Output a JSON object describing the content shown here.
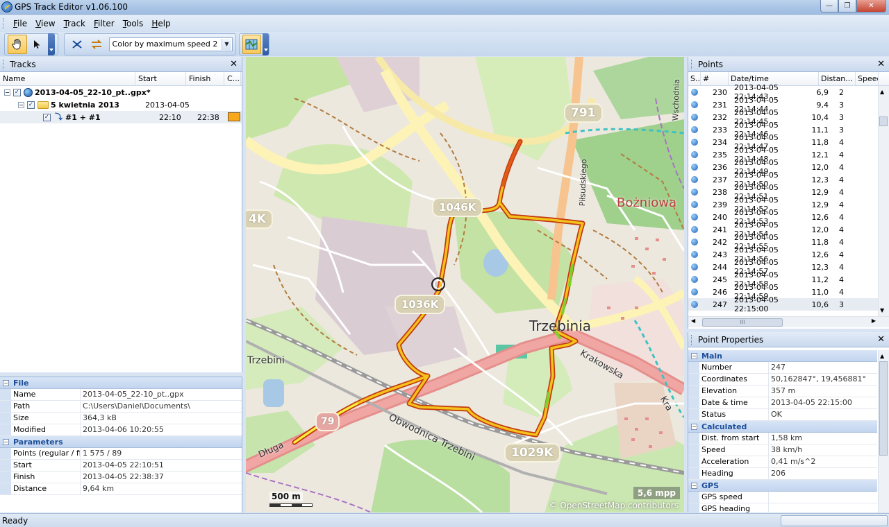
{
  "window": {
    "title": "GPS Track Editor v1.06.100"
  },
  "menu": [
    {
      "label": "File",
      "u": "F",
      "rest": "ile"
    },
    {
      "label": "View",
      "u": "V",
      "rest": "iew"
    },
    {
      "label": "Track",
      "u": "T",
      "rest": "rack"
    },
    {
      "label": "Filter",
      "u": "F",
      "rest": "ilter"
    },
    {
      "label": "Tools",
      "u": "T",
      "rest": "ools"
    },
    {
      "label": "Help",
      "u": "H",
      "rest": "elp"
    }
  ],
  "toolbar": {
    "color_mode": "Color by maximum speed 2"
  },
  "tracks": {
    "title": "Tracks",
    "columns": [
      "Name",
      "Start",
      "Finish",
      "C..."
    ],
    "rows": [
      {
        "name": "2013-04-05_22-10_pt..gpx*",
        "start": "",
        "finish": ""
      },
      {
        "name": "5 kwietnia 2013",
        "start": "2013-04-05",
        "finish": ""
      },
      {
        "name": "#1 + #1",
        "start": "22:10",
        "finish": "22:38",
        "color": "#f8a81c"
      }
    ]
  },
  "file_props": {
    "file_label": "File",
    "rows": [
      {
        "k": "Name",
        "v": "2013-04-05_22-10_pt..gpx"
      },
      {
        "k": "Path",
        "v": "C:\\Users\\Daniel\\Documents\\"
      },
      {
        "k": "Size",
        "v": "364,3 kB"
      },
      {
        "k": "Modified",
        "v": "2013-04-06 10:20:55"
      }
    ],
    "params_label": "Parameters",
    "params": [
      {
        "k": "Points (regular / fil",
        "v": "1 575 / 89"
      },
      {
        "k": "Start",
        "v": "2013-04-05 22:10:51"
      },
      {
        "k": "Finish",
        "v": "2013-04-05 22:38:37"
      },
      {
        "k": "Distance",
        "v": "9,64 km"
      }
    ]
  },
  "map": {
    "labels": {
      "road_791": "791",
      "road_1046k": "1046K",
      "road_1029k": "1029K",
      "road_1036k": "1036K",
      "road_4k": "4K",
      "trzebinia": "Trzebinia",
      "trzebini_left": "Trzebini",
      "krakowska": "Krakowska",
      "krakowska_right": "Kra",
      "obwodnica": "Obwodnica Trzebini",
      "dluga": "Długa",
      "bozniowa": "Bożniowa",
      "pilsudskiego": "Piłsudskiego",
      "wschodnia": "Wschodnia"
    },
    "scale": "500 m",
    "mpp": "5,6 mpp",
    "attribution": "© OpenStreetMap contributors"
  },
  "points": {
    "title": "Points",
    "columns": [
      "S...",
      "#",
      "Date/time",
      "Distan...",
      "Speed"
    ],
    "rows": [
      {
        "num": "230",
        "date": "2013-04-05  22:14:43",
        "dist": "6,9",
        "spd": "2"
      },
      {
        "num": "231",
        "date": "2013-04-05  22:14:44",
        "dist": "9,4",
        "spd": "3"
      },
      {
        "num": "232",
        "date": "2013-04-05  22:14:45",
        "dist": "10,4",
        "spd": "3"
      },
      {
        "num": "233",
        "date": "2013-04-05  22:14:46",
        "dist": "11,1",
        "spd": "3"
      },
      {
        "num": "234",
        "date": "2013-04-05  22:14:47",
        "dist": "11,8",
        "spd": "4"
      },
      {
        "num": "235",
        "date": "2013-04-05  22:14:48",
        "dist": "12,1",
        "spd": "4"
      },
      {
        "num": "236",
        "date": "2013-04-05  22:14:49",
        "dist": "12,0",
        "spd": "4"
      },
      {
        "num": "237",
        "date": "2013-04-05  22:14:50",
        "dist": "12,3",
        "spd": "4"
      },
      {
        "num": "238",
        "date": "2013-04-05  22:14:51",
        "dist": "12,9",
        "spd": "4"
      },
      {
        "num": "239",
        "date": "2013-04-05  22:14:52",
        "dist": "12,9",
        "spd": "4"
      },
      {
        "num": "240",
        "date": "2013-04-05  22:14:53",
        "dist": "12,6",
        "spd": "4"
      },
      {
        "num": "241",
        "date": "2013-04-05  22:14:54",
        "dist": "12,0",
        "spd": "4"
      },
      {
        "num": "242",
        "date": "2013-04-05  22:14:55",
        "dist": "11,8",
        "spd": "4"
      },
      {
        "num": "243",
        "date": "2013-04-05  22:14:56",
        "dist": "12,6",
        "spd": "4"
      },
      {
        "num": "244",
        "date": "2013-04-05  22:14:57",
        "dist": "12,3",
        "spd": "4"
      },
      {
        "num": "245",
        "date": "2013-04-05  22:14:58",
        "dist": "11,2",
        "spd": "4"
      },
      {
        "num": "246",
        "date": "2013-04-05  22:14:59",
        "dist": "11,0",
        "spd": "4"
      },
      {
        "num": "247",
        "date": "2013-04-05  22:15:00",
        "dist": "10,6",
        "spd": "3"
      }
    ],
    "hscroll_thumb": "III"
  },
  "point_props": {
    "title": "Point Properties",
    "main_label": "Main",
    "main": [
      {
        "k": "Number",
        "v": "247"
      },
      {
        "k": "Coordinates",
        "v": "50,162847°, 19,456881°"
      },
      {
        "k": "Elevation",
        "v": "357 m"
      },
      {
        "k": "Date & time",
        "v": "2013-04-05 22:15:00"
      },
      {
        "k": "Status",
        "v": "OK"
      }
    ],
    "calc_label": "Calculated",
    "calc": [
      {
        "k": "Dist. from start",
        "v": "1,58 km"
      },
      {
        "k": "Speed",
        "v": "38 km/h"
      },
      {
        "k": "Acceleration",
        "v": "0,41 m/s^2"
      },
      {
        "k": "Heading",
        "v": "206"
      }
    ],
    "gps_label": "GPS",
    "gps": [
      {
        "k": "GPS speed",
        "v": ""
      },
      {
        "k": "GPS heading",
        "v": ""
      }
    ]
  },
  "status": {
    "text": "Ready"
  }
}
